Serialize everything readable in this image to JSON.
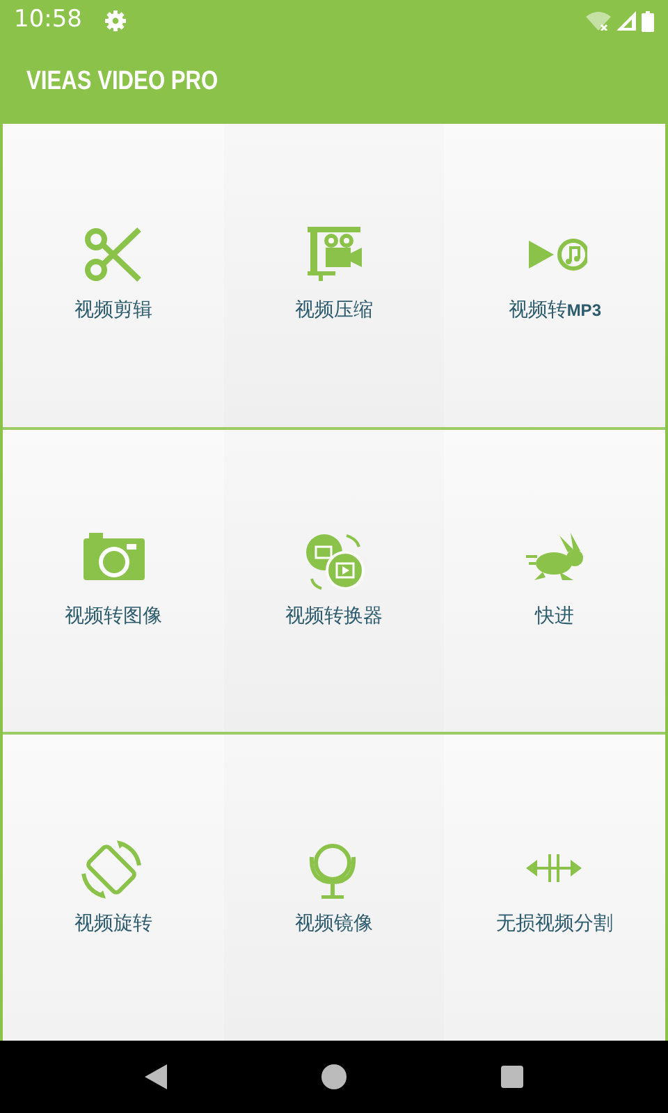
{
  "status_bar": {
    "time": "10:58"
  },
  "app_bar": {
    "title": "VIEAS VIDEO PRO"
  },
  "tiles": [
    {
      "label": "视频剪辑"
    },
    {
      "label": "视频压缩"
    },
    {
      "label": "视频转**MP3**"
    },
    {
      "label": "视频转图像"
    },
    {
      "label": "视频转换器"
    },
    {
      "label": "快进"
    },
    {
      "label": "视频旋转"
    },
    {
      "label": "视频镜像"
    },
    {
      "label": "无损视频分割"
    }
  ]
}
